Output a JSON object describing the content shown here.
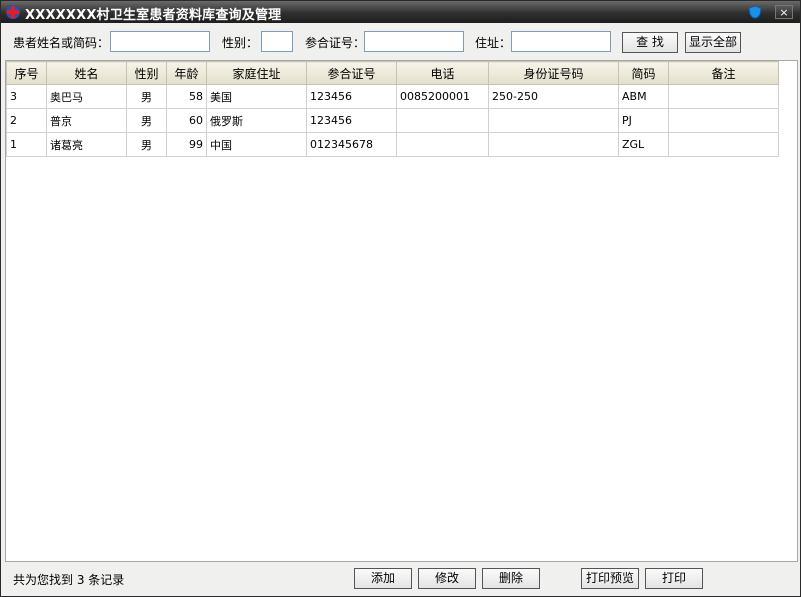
{
  "window": {
    "title": "XXXXXXX村卫生室患者资料库查询及管理",
    "close_label": "×"
  },
  "search": {
    "name_label": "患者姓名或简码：",
    "name_value": "",
    "gender_label": "性别：",
    "gender_value": "",
    "insurance_label": "参合证号：",
    "insurance_value": "",
    "address_label": "住址：",
    "address_value": "",
    "find_label": "查 找",
    "show_all_label": "显示全部"
  },
  "table": {
    "columns": [
      "序号",
      "姓名",
      "性别",
      "年龄",
      "家庭住址",
      "参合证号",
      "电话",
      "身份证号码",
      "简码",
      "备注"
    ],
    "rows": [
      [
        "3",
        "奥巴马",
        "男",
        "58",
        "美国",
        "123456",
        "0085200001",
        "250-250",
        "ABM",
        ""
      ],
      [
        "2",
        "普京",
        "男",
        "60",
        "俄罗斯",
        "123456",
        "",
        "",
        "PJ",
        ""
      ],
      [
        "1",
        "诸葛亮",
        "男",
        "99",
        "中国",
        "012345678",
        "",
        "",
        "ZGL",
        ""
      ]
    ]
  },
  "status": {
    "text": "共为您找到 3 条记录"
  },
  "actions": {
    "add": "添加",
    "edit": "修改",
    "delete": "删除",
    "print_preview": "打印预览",
    "print": "打印"
  },
  "colors": {
    "titlebar": "#2f2f2f",
    "header_bg": "#e3dfcc",
    "window_bg": "#f0f0ee",
    "input_border": "#7f9db9"
  },
  "icons": [
    "medical-cross-icon",
    "shield-icon",
    "close-icon"
  ]
}
